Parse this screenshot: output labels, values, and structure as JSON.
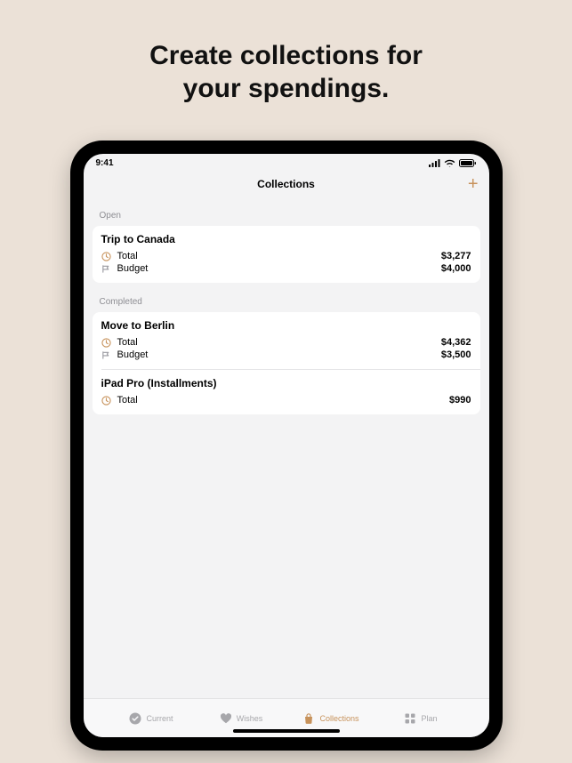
{
  "headline": {
    "line1": "Create collections for",
    "line2": "your spendings."
  },
  "statusbar": {
    "time": "9:41"
  },
  "navbar": {
    "title": "Collections",
    "add": "+"
  },
  "sections": {
    "open": {
      "header": "Open",
      "items": [
        {
          "title": "Trip to Canada",
          "rows": [
            {
              "icon": "total",
              "label": "Total",
              "value": "$3,277"
            },
            {
              "icon": "budget",
              "label": "Budget",
              "value": "$4,000"
            }
          ]
        }
      ]
    },
    "completed": {
      "header": "Completed",
      "items": [
        {
          "title": "Move to Berlin",
          "rows": [
            {
              "icon": "total",
              "label": "Total",
              "value": "$4,362"
            },
            {
              "icon": "budget",
              "label": "Budget",
              "value": "$3,500"
            }
          ]
        },
        {
          "title": "iPad Pro (Installments)",
          "rows": [
            {
              "icon": "total",
              "label": "Total",
              "value": "$990"
            }
          ]
        }
      ]
    }
  },
  "tabs": {
    "current": "Current",
    "wishes": "Wishes",
    "collections": "Collections",
    "plan": "Plan"
  },
  "colors": {
    "accent": "#c7925b"
  }
}
